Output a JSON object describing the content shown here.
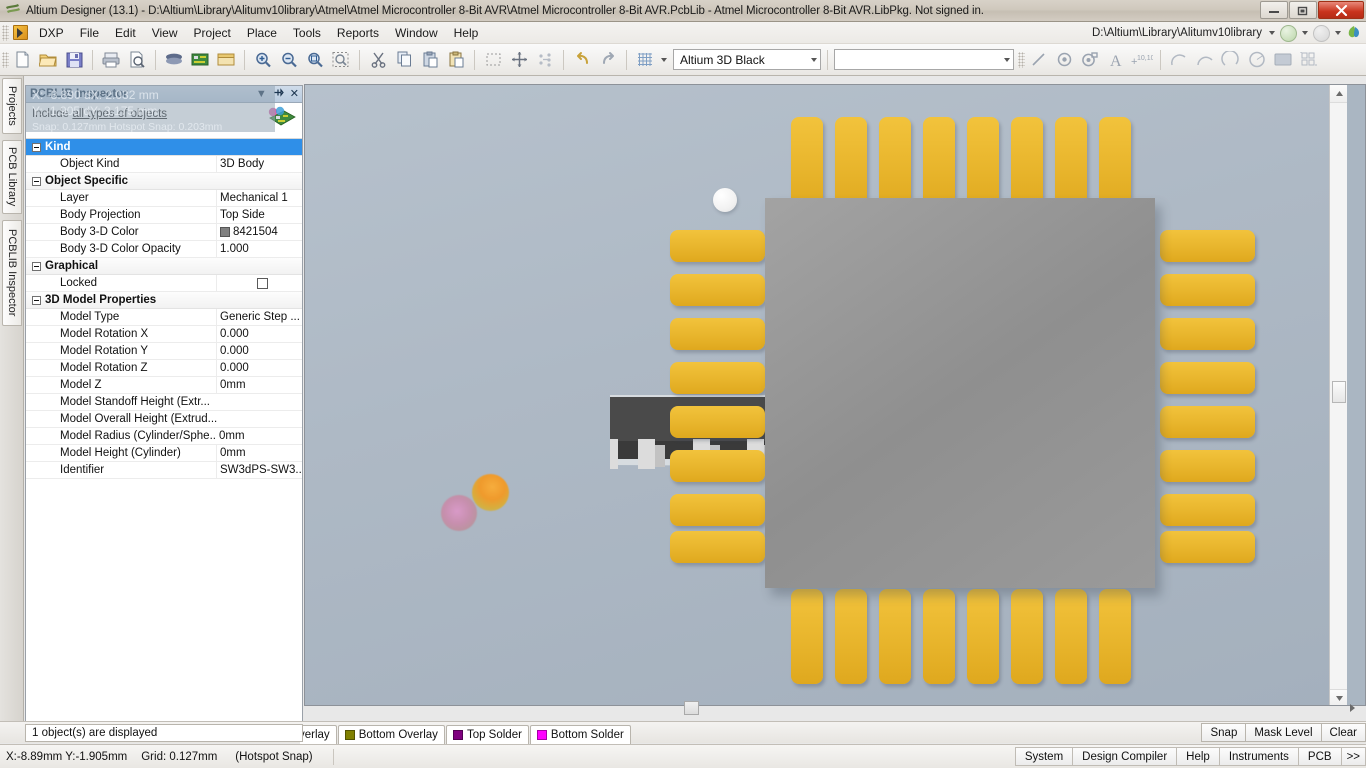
{
  "window": {
    "title": "Altium Designer (13.1) - D:\\Altium\\Library\\Alitumv10library\\Atmel\\Atmel Microcontroller 8-Bit AVR\\Atmel Microcontroller 8-Bit AVR.PcbLib - Atmel Microcontroller 8-Bit AVR.LibPkg. Not signed in.",
    "app_icon": "altium-logo-icon",
    "minimize": "–",
    "maximize": "❐",
    "close": "✕"
  },
  "menubar": {
    "dxp_label": "DXP",
    "items": [
      {
        "label": "File",
        "accel": "F"
      },
      {
        "label": "Edit",
        "accel": "E"
      },
      {
        "label": "View",
        "accel": "V"
      },
      {
        "label": "Project",
        "accel": "j"
      },
      {
        "label": "Place",
        "accel": "c"
      },
      {
        "label": "Tools",
        "accel": "T"
      },
      {
        "label": "Reports",
        "accel": "R"
      },
      {
        "label": "Window",
        "accel": "W"
      },
      {
        "label": "Help",
        "accel": "H"
      }
    ],
    "path_label": "D:\\Altium\\Library\\Alitumv10library",
    "nav_back_icon": "navigate-back-icon",
    "nav_forward_icon": "navigate-forward-icon",
    "leaf_icon": "altium-leaf-icon"
  },
  "toolbar": {
    "groups": [
      [
        "new-document-icon",
        "open-document-icon",
        "save-document-icon"
      ],
      [
        "print-icon",
        "print-preview-icon"
      ],
      [
        "layer-stack-icon",
        "board-icon",
        "library-icon"
      ],
      [
        "zoom-in-icon",
        "zoom-out-icon",
        "zoom-area-icon",
        "zoom-selected-icon"
      ],
      [
        "cut-icon",
        "copy-icon",
        "paste-icon",
        "paste-special-icon"
      ],
      [
        "select-region-icon",
        "move-icon",
        "align-icon"
      ],
      [
        "undo-icon",
        "redo-icon"
      ],
      [
        "grid-icon"
      ]
    ],
    "config_combo_value": "Altium 3D Black",
    "layer_combo_value": "",
    "right_tools": [
      "line-icon",
      "via-icon",
      "pad-icon",
      "string-icon",
      "coordinate-icon",
      "arc-center-icon",
      "arc-edge-icon",
      "arc-any-angle-icon",
      "full-circle-icon",
      "fill-icon",
      "array-paste-icon"
    ]
  },
  "sidebar": {
    "tabs": [
      {
        "label": "Projects",
        "name": "sidebar-tab-projects"
      },
      {
        "label": "PCB Library",
        "name": "sidebar-tab-pcb-library"
      },
      {
        "label": "PCBLIB Inspector",
        "name": "sidebar-tab-pcblib-inspector"
      }
    ]
  },
  "inspector": {
    "title": "PCBLIB Inspector",
    "header_buttons": {
      "dropdown": "▼",
      "pin": "✒",
      "close": "✕"
    },
    "include_prefix": "Include",
    "include_link": "all types of objects",
    "badge_icon": "pcb-document-icon",
    "coord_overlay": {
      "line1": "X: -8.890   dX: 2.032  mm",
      "line2": "Y: -1.905   dY: 3.175  mm",
      "line3": "Snap: 0.127mm  Hotspot Snap: 0.203mm"
    },
    "sections": [
      {
        "name": "Kind",
        "selected": true,
        "rows": [
          {
            "key": "Object Kind",
            "value": "3D Body",
            "type": "text"
          }
        ]
      },
      {
        "name": "Object Specific",
        "selected": false,
        "rows": [
          {
            "key": "Layer",
            "value": "Mechanical 1",
            "type": "text"
          },
          {
            "key": "Body Projection",
            "value": "Top Side",
            "type": "text"
          },
          {
            "key": "Body 3-D Color",
            "value": "8421504",
            "type": "color",
            "color": "#808080"
          },
          {
            "key": "Body 3-D Color Opacity",
            "value": "1.000",
            "type": "text"
          }
        ]
      },
      {
        "name": "Graphical",
        "selected": false,
        "rows": [
          {
            "key": "Locked",
            "value": "",
            "type": "checkbox",
            "checked": false
          }
        ]
      },
      {
        "name": "3D Model Properties",
        "selected": false,
        "rows": [
          {
            "key": "Model Type",
            "value": "Generic Step ...",
            "type": "text"
          },
          {
            "key": "Model Rotation X",
            "value": "0.000",
            "type": "text"
          },
          {
            "key": "Model Rotation Y",
            "value": "0.000",
            "type": "text"
          },
          {
            "key": "Model Rotation Z",
            "value": "0.000",
            "type": "text"
          },
          {
            "key": "Model Z",
            "value": "0mm",
            "type": "text"
          },
          {
            "key": "Model Standoff Height (Extr...",
            "value": "",
            "type": "text"
          },
          {
            "key": "Model Overall Height (Extrud...",
            "value": "",
            "type": "text"
          },
          {
            "key": "Model Radius (Cylinder/Sphe...",
            "value": "0mm",
            "type": "text"
          },
          {
            "key": "Model Height (Cylinder)",
            "value": "0mm",
            "type": "text"
          },
          {
            "key": "Identifier",
            "value": "SW3dPS-SW3...",
            "type": "text"
          }
        ]
      }
    ],
    "status": "1 object(s) are displayed"
  },
  "layerbar": {
    "tabs": [
      {
        "label": "verlay",
        "color": "#d8d800",
        "truncated": true
      },
      {
        "label": "Bottom Overlay",
        "color": "#808000"
      },
      {
        "label": "Top Solder",
        "color": "#800080"
      },
      {
        "label": "Bottom Solder",
        "color": "#ff00ff"
      }
    ],
    "buttons": [
      "Snap",
      "Mask Level",
      "Clear"
    ]
  },
  "statusbar": {
    "coords": "X:-8.89mm Y:-1.905mm",
    "grid": "Grid: 0.127mm",
    "snap_mode": "(Hotspot Snap)",
    "panels": [
      "System",
      "Design Compiler",
      "Help",
      "Instruments",
      "PCB"
    ],
    "overflow": ">>"
  },
  "view3d": {
    "background_top": "#b6c1cc",
    "background_bottom": "#a4b0bd",
    "pad_color": "#eeba30",
    "chip_color": "#999999",
    "soic_body_color": "#4a4a4a",
    "soic_lead_color": "#e2e2e2",
    "sphere_pink": "#d89ac8",
    "sphere_orange": "#f0a030",
    "white_marker": "#ffffff"
  }
}
